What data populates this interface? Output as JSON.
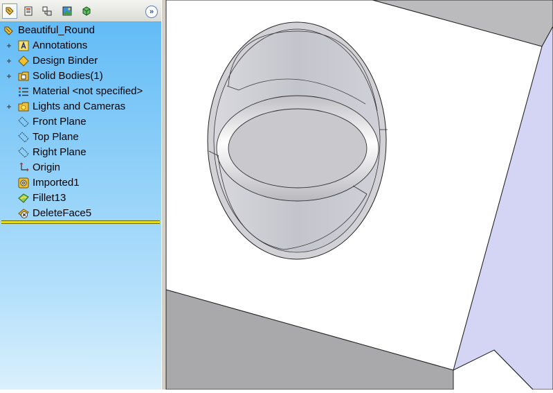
{
  "toolbar": {
    "tabs": [
      {
        "name": "feature-manager-tab",
        "icon": "feature-tree-icon",
        "active": true
      },
      {
        "name": "property-manager-tab",
        "icon": "property-manager-icon",
        "active": false
      },
      {
        "name": "configuration-manager-tab",
        "icon": "configuration-manager-icon",
        "active": false
      },
      {
        "name": "appearance-tab",
        "icon": "appearance-icon",
        "active": false
      },
      {
        "name": "display-manager-tab",
        "icon": "display-manager-icon",
        "active": false
      }
    ],
    "expand_label": "»"
  },
  "tree": {
    "root_label": "Beautiful_Round",
    "items": [
      {
        "label": "Annotations",
        "icon": "annotations-icon",
        "expandable": true
      },
      {
        "label": "Design Binder",
        "icon": "design-binder-icon",
        "expandable": true
      },
      {
        "label": "Solid Bodies(1)",
        "icon": "solid-bodies-icon",
        "expandable": true
      },
      {
        "label": "Material <not specified>",
        "icon": "material-icon",
        "expandable": false
      },
      {
        "label": "Lights and Cameras",
        "icon": "lights-cameras-icon",
        "expandable": true
      },
      {
        "label": "Front Plane",
        "icon": "plane-icon",
        "expandable": false
      },
      {
        "label": "Top Plane",
        "icon": "plane-icon",
        "expandable": false
      },
      {
        "label": "Right Plane",
        "icon": "plane-icon",
        "expandable": false
      },
      {
        "label": "Origin",
        "icon": "origin-icon",
        "expandable": false
      },
      {
        "label": "Imported1",
        "icon": "imported-feature-icon",
        "expandable": false
      },
      {
        "label": "Fillet13",
        "icon": "fillet-icon",
        "expandable": false
      },
      {
        "label": "DeleteFace5",
        "icon": "delete-face-icon",
        "expandable": false
      }
    ]
  },
  "colors": {
    "panel_top": "#5cb8f6",
    "panel_bottom": "#daf0fd",
    "rollback_bar": "#e8e000",
    "model_face": "#ffffff",
    "model_side_gray": "#a8a8aa",
    "model_side_lavender": "#d4d4f4"
  }
}
